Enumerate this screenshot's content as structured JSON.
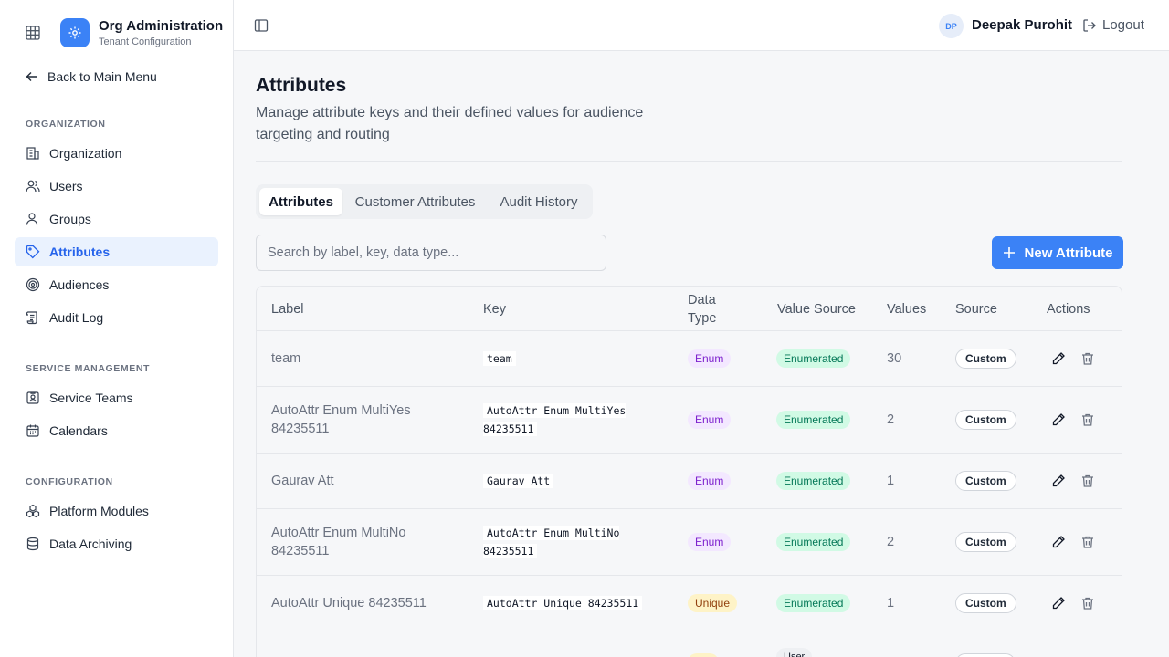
{
  "brand": {
    "title": "Org Administration",
    "subtitle": "Tenant Configuration"
  },
  "nav": {
    "back_label": "Back to Main Menu",
    "sections": [
      {
        "title": "ORGANIZATION",
        "items": [
          "Organization",
          "Users",
          "Groups",
          "Attributes",
          "Audiences",
          "Audit Log"
        ]
      },
      {
        "title": "SERVICE MANAGEMENT",
        "items": [
          "Service Teams",
          "Calendars"
        ]
      },
      {
        "title": "CONFIGURATION",
        "items": [
          "Platform Modules",
          "Data Archiving"
        ]
      }
    ],
    "active": "Attributes"
  },
  "header": {
    "user_initials": "DP",
    "user_name": "Deepak Purohit",
    "logout_label": "Logout"
  },
  "page": {
    "title": "Attributes",
    "description": "Manage attribute keys and their defined values for audience targeting and routing"
  },
  "tabs": [
    {
      "label": "Attributes",
      "active": true
    },
    {
      "label": "Customer Attributes",
      "active": false
    },
    {
      "label": "Audit History",
      "active": false
    }
  ],
  "search": {
    "placeholder": "Search by label, key, data type...",
    "value": ""
  },
  "new_button_label": "New Attribute",
  "table": {
    "columns": {
      "label": "Label",
      "key": "Key",
      "data_type": "Data Type",
      "value_source": "Value Source",
      "values": "Values",
      "source": "Source",
      "actions": "Actions"
    },
    "rows": [
      {
        "label": "team",
        "key": "team",
        "data_type": "Enum",
        "value_source": "Enumerated",
        "values": "30",
        "source": "Custom"
      },
      {
        "label": "AutoAttr Enum MultiYes 84235511",
        "key": "AutoAttr Enum MultiYes 84235511",
        "data_type": "Enum",
        "value_source": "Enumerated",
        "values": "2",
        "source": "Custom"
      },
      {
        "label": "Gaurav Att",
        "key": "Gaurav Att",
        "data_type": "Enum",
        "value_source": "Enumerated",
        "values": "1",
        "source": "Custom"
      },
      {
        "label": "AutoAttr Enum MultiNo 84235511",
        "key": "AutoAttr Enum MultiNo 84235511",
        "data_type": "Enum",
        "value_source": "Enumerated",
        "values": "2",
        "source": "Custom"
      },
      {
        "label": "AutoAttr Unique 84235511",
        "key": "AutoAttr Unique 84235511",
        "data_type": "Unique",
        "value_source": "Enumerated",
        "values": "1",
        "source": "Custom"
      }
    ],
    "partial_row_value_source": "User"
  },
  "colors": {
    "accent": "#3b82f6",
    "active_nav_bg": "#eaf2fe"
  }
}
